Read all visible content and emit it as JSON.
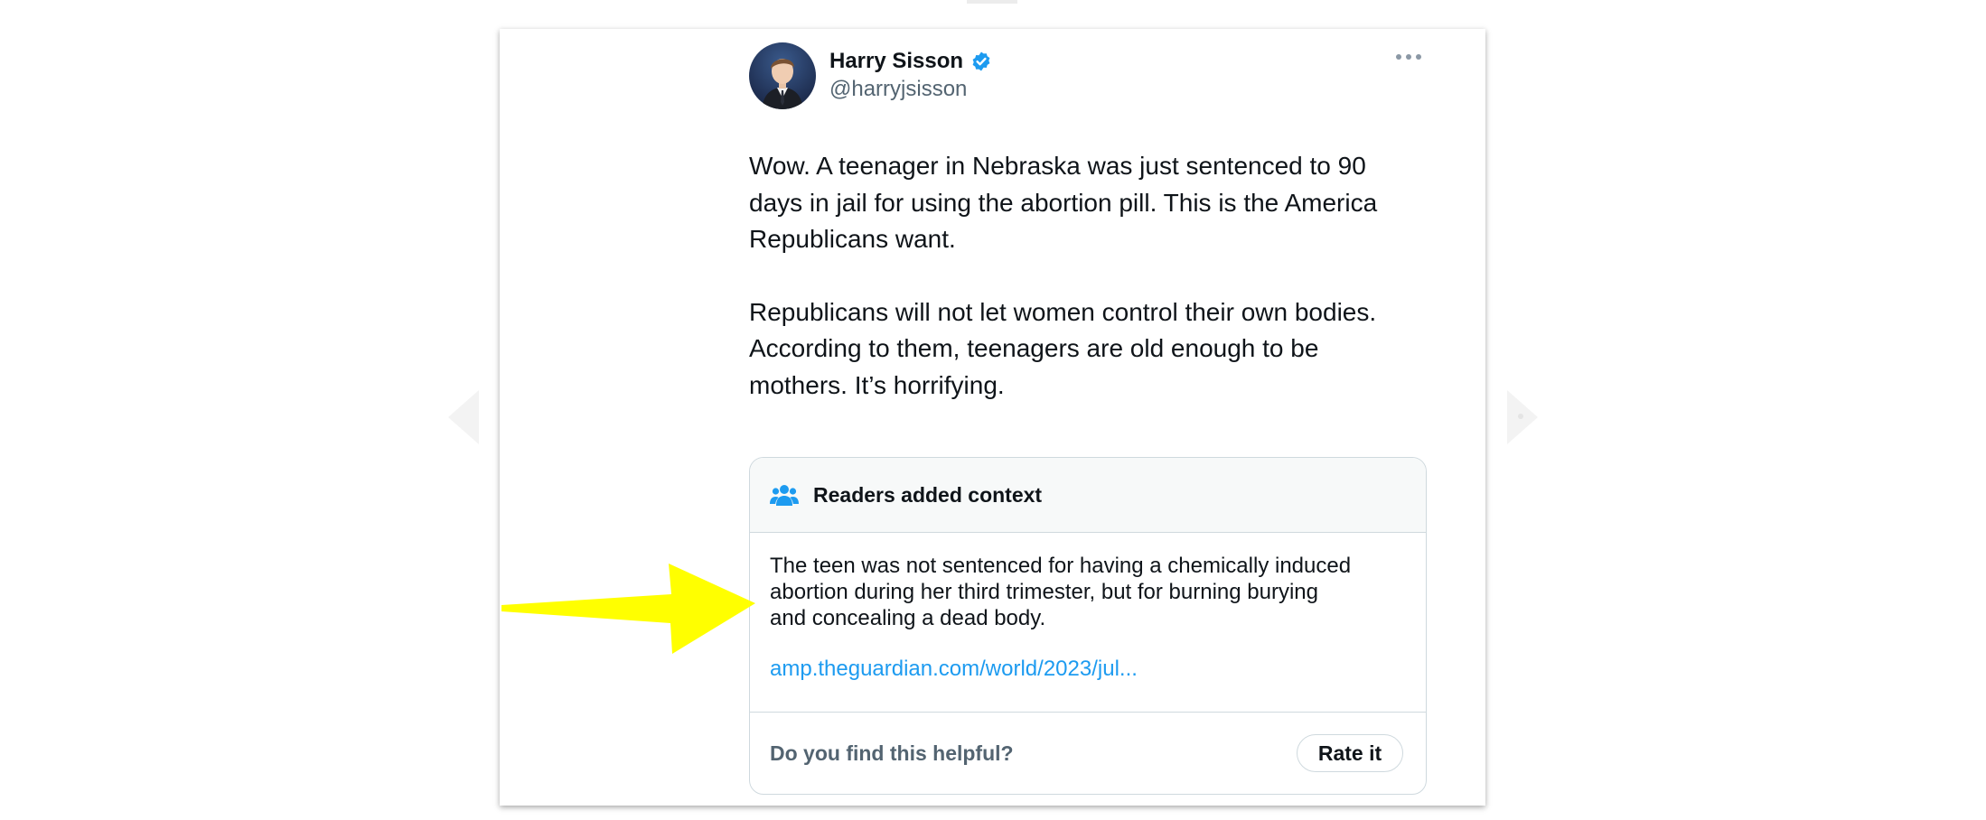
{
  "tweet": {
    "author_name": "Harry Sisson",
    "author_handle": "@harryjsisson",
    "verified_badge": "verified-badge-icon",
    "lines_para1": [
      "Wow. A teenager in Nebraska was just sentenced to 90",
      "days in jail for using the abortion pill. This is the America",
      "Republicans want."
    ],
    "lines_para2": [
      "Republicans will not let women control their own bodies.",
      "According to them, teenagers are old enough to be",
      "mothers. It’s horrifying."
    ]
  },
  "community_note": {
    "title": "Readers added context",
    "icon": "people-icon",
    "body_lines": [
      "The teen was not sentenced for having a chemically induced",
      "abortion during her third trimester, but for burning burying",
      "and concealing a dead body."
    ],
    "link": "amp.theguardian.com/world/2023/jul...",
    "helpful_prompt": "Do you find this helpful?",
    "rate_button": "Rate it"
  },
  "colors": {
    "accent_blue": "#1d9bf0",
    "secondary_text": "#536471",
    "annotation_arrow": "#ffff00"
  }
}
